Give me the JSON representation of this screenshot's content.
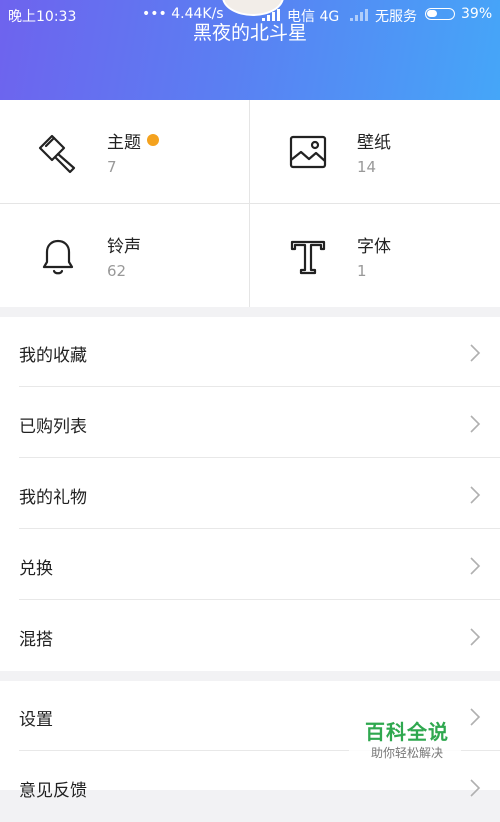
{
  "status_bar": {
    "time": "晚上10:33",
    "network_speed": "••• 4.44K/s",
    "carrier": "电信 4G",
    "no_service": "无服务",
    "battery_percent": "39%",
    "battery_level": 0.39
  },
  "profile": {
    "name": "黑夜的北斗星"
  },
  "categories": [
    {
      "label": "主题",
      "count": "7",
      "icon": "paintbrush-icon",
      "has_badge": true
    },
    {
      "label": "壁纸",
      "count": "14",
      "icon": "picture-icon"
    },
    {
      "label": "铃声",
      "count": "62",
      "icon": "bell-icon"
    },
    {
      "label": "字体",
      "count": "1",
      "icon": "font-t-icon"
    }
  ],
  "menu": {
    "group1": [
      "我的收藏",
      "已购列表",
      "我的礼物",
      "兑换",
      "混搭"
    ],
    "group2": [
      "设置",
      "意见反馈"
    ]
  },
  "watermark": {
    "title": "百科全说",
    "subtitle": "助你轻松解决"
  },
  "colors": {
    "header_gradient_start": "#6e63ee",
    "header_gradient_end": "#45a6f8",
    "badge_dot": "#f4a21e",
    "watermark_green": "#2fa84f"
  }
}
